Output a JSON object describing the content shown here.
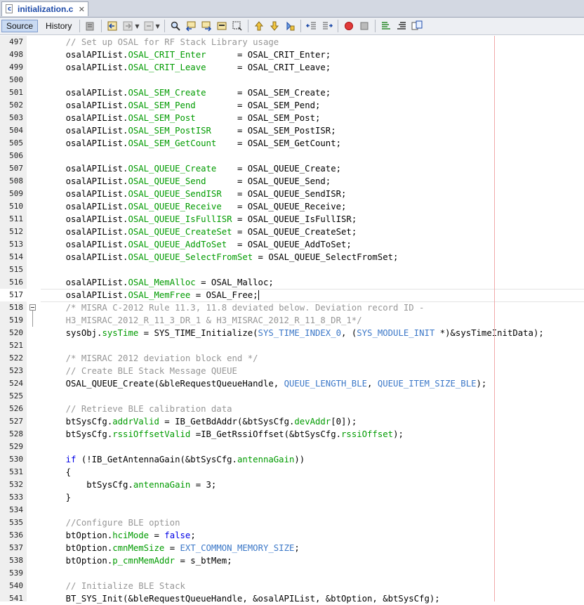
{
  "file_tab": {
    "filename": "initialization.c",
    "close_glyph": "✕",
    "icon_letter": "c"
  },
  "toolbar": {
    "source_label": "Source",
    "history_label": "History",
    "buttons": [
      "last-edit-icon",
      "back-icon",
      "forward-icon",
      "find-icon",
      "find-previous-icon",
      "find-next-icon",
      "toggle-highlight-icon",
      "toggle-rect-select-icon",
      "previous-bookmark-icon",
      "next-bookmark-icon",
      "toggle-bookmark-icon",
      "shift-left-icon",
      "shift-right-icon",
      "start-macro-icon",
      "stop-macro-icon",
      "comment-icon",
      "uncomment-icon",
      "diff-icon"
    ]
  },
  "colors": {
    "comment": "#969696",
    "field": "#009b00",
    "keyword": "#0000e6",
    "macro": "#3c78c8",
    "margin_line": "#f0a8a8"
  },
  "editor": {
    "current_line": 517,
    "fold_marker_line": 518,
    "lines": [
      {
        "n": "497",
        "t": [
          [
            "    // Set up OSAL for RF Stack Library usage",
            "cmt"
          ]
        ]
      },
      {
        "n": "498",
        "t": [
          [
            "    osalAPIList.",
            ""
          ],
          [
            "OSAL_CRIT_Enter",
            "fld"
          ],
          [
            "      = OSAL_CRIT_Enter;",
            ""
          ]
        ]
      },
      {
        "n": "499",
        "t": [
          [
            "    osalAPIList.",
            ""
          ],
          [
            "OSAL_CRIT_Leave",
            "fld"
          ],
          [
            "      = OSAL_CRIT_Leave;",
            ""
          ]
        ]
      },
      {
        "n": "500",
        "t": [
          [
            "",
            ""
          ]
        ]
      },
      {
        "n": "501",
        "t": [
          [
            "    osalAPIList.",
            ""
          ],
          [
            "OSAL_SEM_Create",
            "fld"
          ],
          [
            "      = OSAL_SEM_Create;",
            ""
          ]
        ]
      },
      {
        "n": "502",
        "t": [
          [
            "    osalAPIList.",
            ""
          ],
          [
            "OSAL_SEM_Pend",
            "fld"
          ],
          [
            "        = OSAL_SEM_Pend;",
            ""
          ]
        ]
      },
      {
        "n": "503",
        "t": [
          [
            "    osalAPIList.",
            ""
          ],
          [
            "OSAL_SEM_Post",
            "fld"
          ],
          [
            "        = OSAL_SEM_Post;",
            ""
          ]
        ]
      },
      {
        "n": "504",
        "t": [
          [
            "    osalAPIList.",
            ""
          ],
          [
            "OSAL_SEM_PostISR",
            "fld"
          ],
          [
            "     = OSAL_SEM_PostISR;",
            ""
          ]
        ]
      },
      {
        "n": "505",
        "t": [
          [
            "    osalAPIList.",
            ""
          ],
          [
            "OSAL_SEM_GetCount",
            "fld"
          ],
          [
            "    = OSAL_SEM_GetCount;",
            ""
          ]
        ]
      },
      {
        "n": "506",
        "t": [
          [
            "",
            ""
          ]
        ]
      },
      {
        "n": "507",
        "t": [
          [
            "    osalAPIList.",
            ""
          ],
          [
            "OSAL_QUEUE_Create",
            "fld"
          ],
          [
            "    = OSAL_QUEUE_Create;",
            ""
          ]
        ]
      },
      {
        "n": "508",
        "t": [
          [
            "    osalAPIList.",
            ""
          ],
          [
            "OSAL_QUEUE_Send",
            "fld"
          ],
          [
            "      = OSAL_QUEUE_Send;",
            ""
          ]
        ]
      },
      {
        "n": "509",
        "t": [
          [
            "    osalAPIList.",
            ""
          ],
          [
            "OSAL_QUEUE_SendISR",
            "fld"
          ],
          [
            "   = OSAL_QUEUE_SendISR;",
            ""
          ]
        ]
      },
      {
        "n": "510",
        "t": [
          [
            "    osalAPIList.",
            ""
          ],
          [
            "OSAL_QUEUE_Receive",
            "fld"
          ],
          [
            "   = OSAL_QUEUE_Receive;",
            ""
          ]
        ]
      },
      {
        "n": "511",
        "t": [
          [
            "    osalAPIList.",
            ""
          ],
          [
            "OSAL_QUEUE_IsFullISR",
            "fld"
          ],
          [
            " = OSAL_QUEUE_IsFullISR;",
            ""
          ]
        ]
      },
      {
        "n": "512",
        "t": [
          [
            "    osalAPIList.",
            ""
          ],
          [
            "OSAL_QUEUE_CreateSet",
            "fld"
          ],
          [
            " = OSAL_QUEUE_CreateSet;",
            ""
          ]
        ]
      },
      {
        "n": "513",
        "t": [
          [
            "    osalAPIList.",
            ""
          ],
          [
            "OSAL_QUEUE_AddToSet",
            "fld"
          ],
          [
            "  = OSAL_QUEUE_AddToSet;",
            ""
          ]
        ]
      },
      {
        "n": "514",
        "t": [
          [
            "    osalAPIList.",
            ""
          ],
          [
            "OSAL_QUEUE_SelectFromSet",
            "fld"
          ],
          [
            " = OSAL_QUEUE_SelectFromSet;",
            ""
          ]
        ]
      },
      {
        "n": "515",
        "t": [
          [
            "",
            ""
          ]
        ]
      },
      {
        "n": "516",
        "t": [
          [
            "    osalAPIList.",
            ""
          ],
          [
            "OSAL_MemAlloc",
            "fld"
          ],
          [
            " = OSAL_Malloc;",
            ""
          ]
        ]
      },
      {
        "n": "517",
        "t": [
          [
            "    osalAPIList.",
            ""
          ],
          [
            "OSAL_MemFree",
            "fld"
          ],
          [
            " = OSAL_Free;",
            ""
          ]
        ]
      },
      {
        "n": "518",
        "t": [
          [
            "    /* MISRA C-2012 Rule 11.3, 11.8 deviated below. Deviation record ID -",
            "cmt"
          ]
        ]
      },
      {
        "n": "519",
        "t": [
          [
            "    H3_MISRAC_2012_R_11_3_DR_1 & H3_MISRAC_2012_R_11_8_DR_1*/",
            "cmt"
          ]
        ]
      },
      {
        "n": "520",
        "t": [
          [
            "    sysObj.",
            ""
          ],
          [
            "sysTime",
            "fld"
          ],
          [
            " = SYS_TIME_Initialize(",
            ""
          ],
          [
            "SYS_TIME_INDEX_0",
            "mac"
          ],
          [
            ", (",
            ""
          ],
          [
            "SYS_MODULE_INIT",
            "mac"
          ],
          [
            " *)&sysTimeInitData);",
            ""
          ]
        ]
      },
      {
        "n": "521",
        "t": [
          [
            "",
            ""
          ]
        ]
      },
      {
        "n": "522",
        "t": [
          [
            "    /* MISRAC 2012 deviation block end */",
            "cmt"
          ]
        ]
      },
      {
        "n": "523",
        "t": [
          [
            "    // Create BLE Stack Message QUEUE",
            "cmt"
          ]
        ]
      },
      {
        "n": "524",
        "t": [
          [
            "    OSAL_QUEUE_Create(&bleRequestQueueHandle, ",
            ""
          ],
          [
            "QUEUE_LENGTH_BLE",
            "mac"
          ],
          [
            ", ",
            ""
          ],
          [
            "QUEUE_ITEM_SIZE_BLE",
            "mac"
          ],
          [
            ");",
            ""
          ]
        ]
      },
      {
        "n": "525",
        "t": [
          [
            "",
            ""
          ]
        ]
      },
      {
        "n": "526",
        "t": [
          [
            "    // Retrieve BLE calibration data",
            "cmt"
          ]
        ]
      },
      {
        "n": "527",
        "t": [
          [
            "    btSysCfg.",
            ""
          ],
          [
            "addrValid",
            "fld"
          ],
          [
            " = IB_GetBdAddr(&btSysCfg.",
            ""
          ],
          [
            "devAddr",
            "fld"
          ],
          [
            "[0]);",
            ""
          ]
        ]
      },
      {
        "n": "528",
        "t": [
          [
            "    btSysCfg.",
            ""
          ],
          [
            "rssiOffsetValid",
            "fld"
          ],
          [
            " =IB_GetRssiOffset(&btSysCfg.",
            ""
          ],
          [
            "rssiOffset",
            "fld"
          ],
          [
            ");",
            ""
          ]
        ]
      },
      {
        "n": "529",
        "t": [
          [
            "",
            ""
          ]
        ]
      },
      {
        "n": "530",
        "t": [
          [
            "    ",
            ""
          ],
          [
            "if",
            "kw"
          ],
          [
            " (!IB_GetAntennaGain(&btSysCfg.",
            ""
          ],
          [
            "antennaGain",
            "fld"
          ],
          [
            "))",
            ""
          ]
        ]
      },
      {
        "n": "531",
        "t": [
          [
            "    {",
            ""
          ]
        ]
      },
      {
        "n": "532",
        "t": [
          [
            "        btSysCfg.",
            ""
          ],
          [
            "antennaGain",
            "fld"
          ],
          [
            " = 3;",
            ""
          ]
        ]
      },
      {
        "n": "533",
        "t": [
          [
            "    }",
            ""
          ]
        ]
      },
      {
        "n": "534",
        "t": [
          [
            "",
            ""
          ]
        ]
      },
      {
        "n": "535",
        "t": [
          [
            "    //Configure BLE option",
            "cmt"
          ]
        ]
      },
      {
        "n": "536",
        "t": [
          [
            "    btOption.",
            ""
          ],
          [
            "hciMode",
            "fld"
          ],
          [
            " = ",
            ""
          ],
          [
            "false",
            "kw"
          ],
          [
            ";",
            ""
          ]
        ]
      },
      {
        "n": "537",
        "t": [
          [
            "    btOption.",
            ""
          ],
          [
            "cmnMemSize",
            "fld"
          ],
          [
            " = ",
            ""
          ],
          [
            "EXT_COMMON_MEMORY_SIZE",
            "mac"
          ],
          [
            ";",
            ""
          ]
        ]
      },
      {
        "n": "538",
        "t": [
          [
            "    btOption.",
            ""
          ],
          [
            "p_cmnMemAddr",
            "fld"
          ],
          [
            " = s_btMem;",
            ""
          ]
        ]
      },
      {
        "n": "539",
        "t": [
          [
            "",
            ""
          ]
        ]
      },
      {
        "n": "540",
        "t": [
          [
            "    // Initialize BLE Stack",
            "cmt"
          ]
        ]
      },
      {
        "n": "541",
        "t": [
          [
            "    BT_SYS_Init(&bleRequestQueueHandle, &osalAPIList, &btOption, &btSysCfg);",
            ""
          ]
        ]
      }
    ]
  }
}
